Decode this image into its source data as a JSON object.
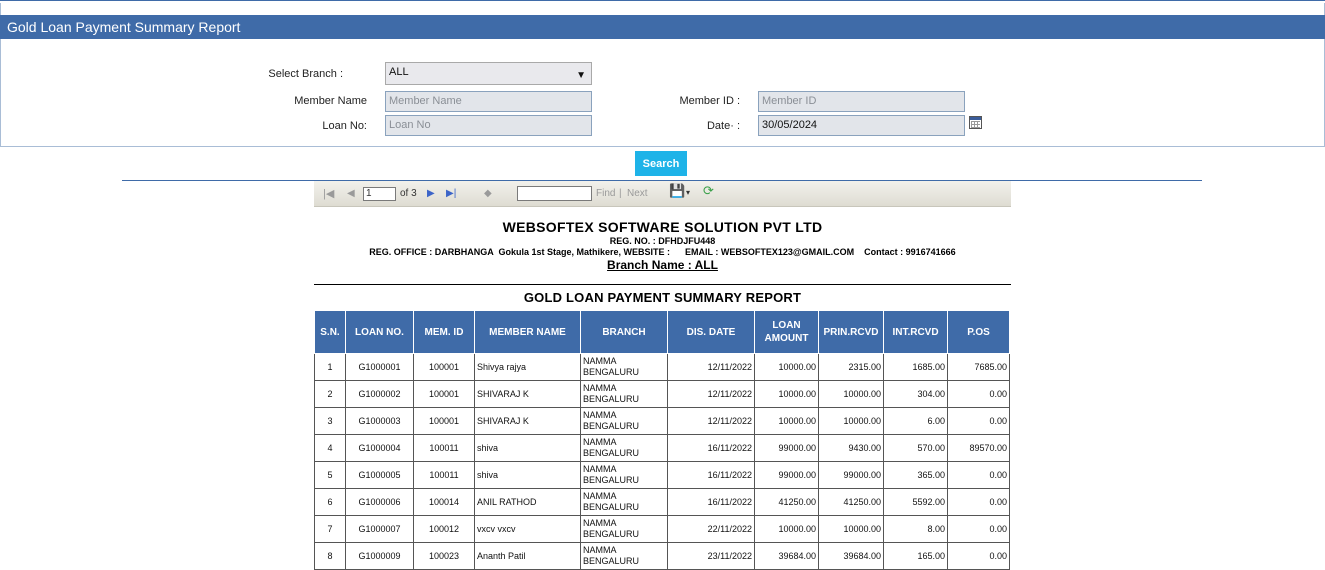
{
  "header": {
    "title": "Gold Loan Payment Summary Report"
  },
  "form": {
    "branch_label": "Select Branch :",
    "branch_value": "ALL",
    "member_name_label": "Member Name",
    "member_name_placeholder": "Member Name",
    "member_id_label": "Member ID :",
    "member_id_placeholder": "Member ID",
    "loan_no_label": "Loan No:",
    "loan_no_placeholder": "Loan No",
    "date_label": "Date· :",
    "date_value": "30/05/2024",
    "search_label": "Search"
  },
  "toolbar": {
    "page_current": "1",
    "page_of": "of 3",
    "find_label": "Find",
    "separator": "|",
    "next_label": "Next"
  },
  "report": {
    "company": "WEBSOFTEX SOFTWARE SOLUTION PVT LTD",
    "reg_no": "REG. NO. : DFHDJFU448",
    "office_line": "REG. OFFICE : DARBHANGA  Gokula 1st Stage, Mathikere, WEBSITE :      EMAIL : WEBSOFTEX123@GMAIL.COM    Contact : 9916741666",
    "branch_name": "Branch Name : ALL",
    "title": "GOLD  LOAN PAYMENT SUMMARY REPORT",
    "columns": [
      "S.N.",
      "LOAN NO.",
      "MEM. ID",
      "MEMBER NAME",
      "BRANCH",
      "DIS. DATE",
      "LOAN AMOUNT",
      "PRIN.RCVD",
      "INT.RCVD",
      "P.OS"
    ],
    "rows": [
      [
        "1",
        "G1000001",
        "100001",
        "Shivya rajya",
        "NAMMA BENGALURU",
        "12/11/2022",
        "10000.00",
        "2315.00",
        "1685.00",
        "7685.00"
      ],
      [
        "2",
        "G1000002",
        "100001",
        "SHIVARAJ K",
        "NAMMA BENGALURU",
        "12/11/2022",
        "10000.00",
        "10000.00",
        "304.00",
        "0.00"
      ],
      [
        "3",
        "G1000003",
        "100001",
        "SHIVARAJ K",
        "NAMMA BENGALURU",
        "12/11/2022",
        "10000.00",
        "10000.00",
        "6.00",
        "0.00"
      ],
      [
        "4",
        "G1000004",
        "100011",
        "shiva",
        "NAMMA BENGALURU",
        "16/11/2022",
        "99000.00",
        "9430.00",
        "570.00",
        "89570.00"
      ],
      [
        "5",
        "G1000005",
        "100011",
        "shiva",
        "NAMMA BENGALURU",
        "16/11/2022",
        "99000.00",
        "99000.00",
        "365.00",
        "0.00"
      ],
      [
        "6",
        "G1000006",
        "100014",
        "ANIL RATHOD",
        "NAMMA BENGALURU",
        "16/11/2022",
        "41250.00",
        "41250.00",
        "5592.00",
        "0.00"
      ],
      [
        "7",
        "G1000007",
        "100012",
        "vxcv vxcv",
        "NAMMA BENGALURU",
        "22/11/2022",
        "10000.00",
        "10000.00",
        "8.00",
        "0.00"
      ],
      [
        "8",
        "G1000009",
        "100023",
        "Ananth Patil",
        "NAMMA BENGALURU",
        "23/11/2022",
        "39684.00",
        "39684.00",
        "165.00",
        "0.00"
      ]
    ]
  }
}
